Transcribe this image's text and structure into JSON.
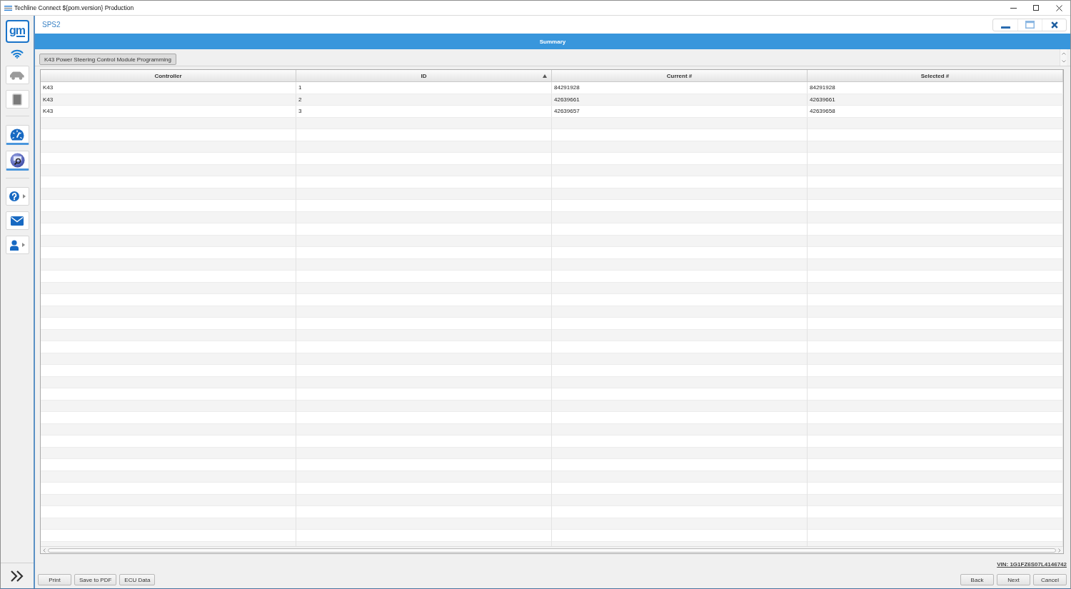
{
  "window": {
    "title": "Techline Connect ${pom.version} Production"
  },
  "sidebar": {
    "logo": "gm",
    "tool_groups": [
      {
        "tools": [
          {
            "disabled": true,
            "active": false,
            "menu": false
          },
          {
            "disabled": false,
            "active": false,
            "menu": false
          }
        ]
      },
      {
        "tools": [
          {
            "disabled": false,
            "active": true,
            "menu": false
          },
          {
            "disabled": false,
            "active": true,
            "menu": false
          }
        ]
      },
      {
        "tools": [
          {
            "disabled": false,
            "active": false,
            "menu": true
          },
          {
            "disabled": false,
            "active": false,
            "menu": false
          },
          {
            "disabled": false,
            "active": false,
            "menu": true
          }
        ]
      }
    ]
  },
  "panel": {
    "title": "SPS2",
    "banner": "Summary",
    "module_tab": "K43 Power Steering Control Module Programming"
  },
  "table": {
    "columns": [
      {
        "label": "Controller",
        "sorted": false
      },
      {
        "label": "ID",
        "sorted": true
      },
      {
        "label": "Current #",
        "sorted": false
      },
      {
        "label": "Selected #",
        "sorted": false
      }
    ],
    "rows": [
      [
        "K43",
        "1",
        "84291928",
        "84291928"
      ],
      [
        "K43",
        "2",
        "42639661",
        "42639661"
      ],
      [
        "K43",
        "3",
        "42639657",
        "42639658"
      ]
    ]
  },
  "vin": "VIN: 1G1FZ6S07L4146742",
  "left_buttons": [
    "Print",
    "Save to PDF",
    "ECU Data"
  ],
  "right_buttons": [
    "Back",
    "Next",
    "Cancel"
  ]
}
